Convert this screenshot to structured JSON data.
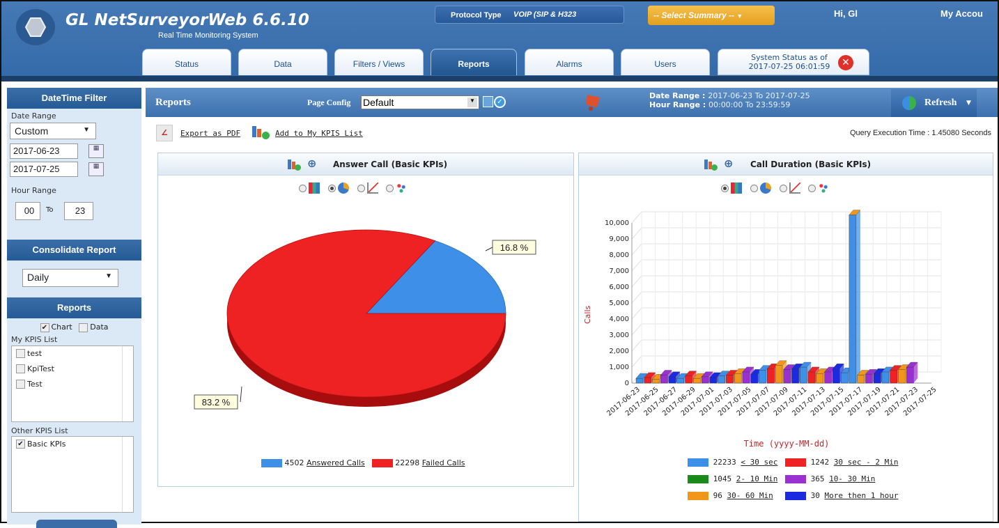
{
  "header": {
    "app_title": "GL NetSurveyorWeb 6.6.10",
    "app_subtitle": "Real Time Monitoring System",
    "protocol_label": "Protocol Type",
    "protocol_value": "VOIP (SIP & H323",
    "summary_placeholder": "-- Select Summary --",
    "greeting": "Hi, Gl",
    "account": "My Accou"
  },
  "tabs": [
    {
      "label": "Status"
    },
    {
      "label": "Data"
    },
    {
      "label": "Filters / Views"
    },
    {
      "label": "Reports",
      "active": true
    },
    {
      "label": "Alarms"
    },
    {
      "label": "Users"
    }
  ],
  "system_status": {
    "line1": "System Status as of",
    "line2": "2017-07-25 06:01:59"
  },
  "sidebar": {
    "datetime_title": "DateTime Filter",
    "date_range_label": "Date Range",
    "date_range_value": "Custom",
    "date_from": "2017-06-23",
    "date_to": "2017-07-25",
    "hour_range_label": "Hour Range",
    "hour_from": "00",
    "hour_to_label": "To",
    "hour_to": "23",
    "consolidate_title": "Consolidate Report",
    "consolidate_value": "Daily",
    "reports_title": "Reports",
    "chart_label": "Chart",
    "data_label": "Data",
    "my_kpis_label": "My KPIS List",
    "my_kpis": [
      "test",
      "KpiTest",
      "Test"
    ],
    "other_kpis_label": "Other KPIS List",
    "other_kpis": [
      "Basic KPIs"
    ]
  },
  "main": {
    "title": "Reports",
    "page_config_label": "Page Config",
    "page_config_value": "Default",
    "date_range_label": "Date Range :",
    "date_range_value": "2017-06-23 To 2017-07-25",
    "hour_range_label": "Hour Range :",
    "hour_range_value": "00:00:00 To 23:59:59",
    "refresh_label": "Refresh",
    "export_pdf": "Export as PDF",
    "add_kpis": "Add to My KPIS List",
    "query_time": "Query Execution Time : 1.45080 Seconds"
  },
  "chart_data": [
    {
      "type": "pie",
      "title": "Answer Call (Basic KPIs)",
      "slices": [
        {
          "name": "Answered Calls",
          "value": 4502,
          "label": "16.8 %",
          "color": "#3d8fe8"
        },
        {
          "name": "Failed Calls",
          "value": 22298,
          "label": "83.2 %",
          "color": "#ee2222"
        }
      ]
    },
    {
      "type": "bar",
      "title": "Call Duration (Basic KPIs)",
      "xlabel": "Time (yyyy-MM-dd)",
      "ylabel": "Calls",
      "ylim": [
        0,
        10000
      ],
      "yticks": [
        "0",
        "1,000",
        "2,000",
        "3,000",
        "4,000",
        "5,000",
        "6,000",
        "7,000",
        "8,000",
        "9,000",
        "10,000"
      ],
      "xticks": [
        "2017-06-23",
        "2017-06-25",
        "2017-06-27",
        "2017-06-29",
        "2017-07-01",
        "2017-07-03",
        "2017-07-05",
        "2017-07-07",
        "2017-07-09",
        "2017-07-11",
        "2017-07-13",
        "2017-07-15",
        "2017-07-17",
        "2017-07-19",
        "2017-07-21",
        "2017-07-23",
        "2017-07-25"
      ],
      "series_values": [
        300,
        350,
        250,
        500,
        400,
        300,
        450,
        300,
        400,
        350,
        450,
        500,
        600,
        700,
        550,
        800,
        900,
        1100,
        850,
        900,
        1000,
        700,
        600,
        700,
        900,
        650,
        10500,
        500,
        550,
        600,
        700,
        800,
        850,
        1000
      ],
      "legend": [
        {
          "count": "22233",
          "name": "< 30 sec",
          "color": "#3d8fe8"
        },
        {
          "count": "1242",
          "name": "30 sec - 2 Min",
          "color": "#ee2222"
        },
        {
          "count": "1045",
          "name": "2- 10 Min",
          "color": "#1a8a1a"
        },
        {
          "count": "365",
          "name": "10- 30 Min",
          "color": "#9a30d0"
        },
        {
          "count": "96",
          "name": "30- 60 Min",
          "color": "#f0961a"
        },
        {
          "count": "30",
          "name": "More then 1 hour",
          "color": "#1a2ae0"
        }
      ]
    }
  ]
}
